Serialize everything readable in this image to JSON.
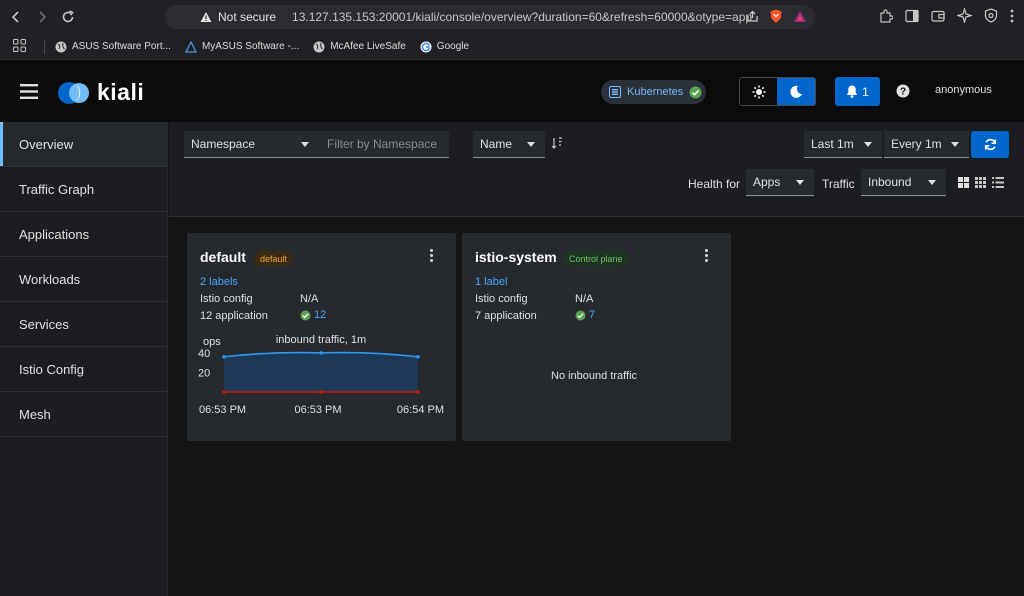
{
  "browser": {
    "security_label": "Not secure",
    "url": "13.127.135.153:20001/kiali/console/overview?duration=60&refresh=60000&otype=app",
    "bookmarks": [
      {
        "label": "ASUS Software Port...",
        "icon": "globe-icon"
      },
      {
        "label": "MyASUS Software -...",
        "icon": "asus-icon"
      },
      {
        "label": "McAfee LiveSafe",
        "icon": "globe-icon"
      },
      {
        "label": "Google",
        "icon": "google-icon"
      }
    ]
  },
  "header": {
    "logo_text": "kiali",
    "cluster_label": "Kubernetes",
    "notification_count": "1",
    "user": "anonymous"
  },
  "sidebar": {
    "items": [
      {
        "label": "Overview",
        "active": true
      },
      {
        "label": "Traffic Graph"
      },
      {
        "label": "Applications"
      },
      {
        "label": "Workloads"
      },
      {
        "label": "Services"
      },
      {
        "label": "Istio Config"
      },
      {
        "label": "Mesh"
      }
    ]
  },
  "toolbar": {
    "filter_type": "Namespace",
    "filter_placeholder": "Filter by Namespace",
    "sort_field": "Name",
    "duration": "Last 1m",
    "refresh_interval": "Every 1m",
    "health_for_label": "Health for",
    "health_for_value": "Apps",
    "traffic_label": "Traffic",
    "traffic_value": "Inbound"
  },
  "cards": [
    {
      "name": "default",
      "badge": "default",
      "labels_link": "2 labels",
      "istio_config_label": "Istio config",
      "istio_config_value": "N/A",
      "app_label": "12 application",
      "app_count": "12",
      "chart_title": "inbound traffic, 1m",
      "chart_unit": "ops"
    },
    {
      "name": "istio-system",
      "badge": "Control plane",
      "labels_link": "1 label",
      "istio_config_label": "Istio config",
      "istio_config_value": "N/A",
      "app_label": "7 application",
      "app_count": "7",
      "no_traffic": "No inbound traffic"
    }
  ],
  "chart_data": {
    "type": "area",
    "title": "inbound traffic, 1m",
    "ylabel": "ops",
    "x": [
      "06:53 PM",
      "06:53 PM",
      "06:54 PM"
    ],
    "yticks": [
      40,
      20
    ],
    "ylim": [
      0,
      46
    ],
    "series": [
      {
        "values": [
          36,
          40,
          36
        ],
        "color": "#2b9af3"
      },
      {
        "values": [
          0,
          0,
          0
        ],
        "color": "#c9190b"
      }
    ]
  },
  "colors": {
    "accent": "#0066cc",
    "link": "#4da6ff",
    "success": "#3e8635",
    "default_badge": "#f0ab00",
    "control_plane_badge": "#5ba352"
  }
}
